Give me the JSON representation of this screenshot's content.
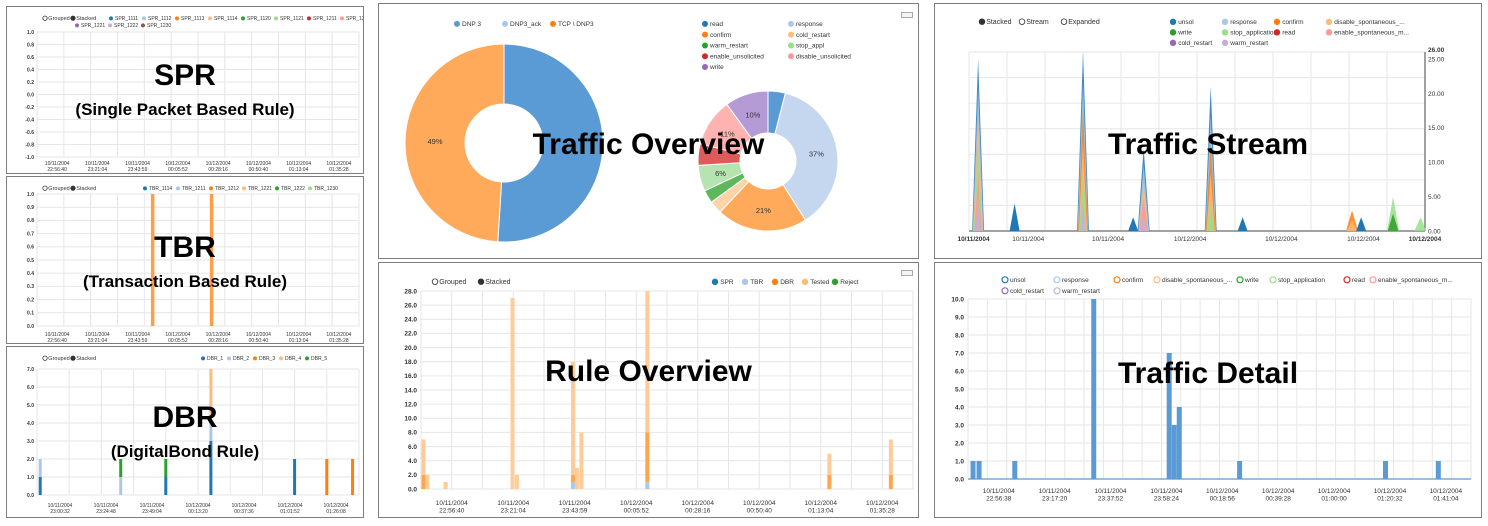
{
  "colors": {
    "blue": "#1f77b4",
    "lightblue": "#aec7e8",
    "orange": "#ff7f0e",
    "lightorange": "#ffbb78",
    "green": "#2ca02c",
    "lightgreen": "#98df8a",
    "red": "#d62728",
    "pink": "#ff9896",
    "purple": "#9467bd",
    "lavender": "#c5b0d5",
    "steelblue": "#5b9bd5"
  },
  "panels": {
    "spr": {
      "title": "SPR",
      "subtitle": "(Single Packet Based Rule)",
      "mode_labels": [
        "Grouped",
        "Stacked"
      ],
      "legend": [
        {
          "label": "SPR_1111",
          "color": "#1f77b4"
        },
        {
          "label": "SPR_1112",
          "color": "#aec7e8"
        },
        {
          "label": "SPR_1113",
          "color": "#ff7f0e"
        },
        {
          "label": "SPR_1114",
          "color": "#ffbb78"
        },
        {
          "label": "SPR_1120",
          "color": "#2ca02c"
        },
        {
          "label": "SPR_1121",
          "color": "#98df8a"
        },
        {
          "label": "SPR_1211",
          "color": "#d62728"
        },
        {
          "label": "SPR_1212",
          "color": "#ff9896"
        },
        {
          "label": "SPR_1221",
          "color": "#9467bd"
        },
        {
          "label": "SPR_1222",
          "color": "#c5b0d5"
        },
        {
          "label": "SPR_1230",
          "color": "#8c564b"
        }
      ],
      "y_ticks": [
        "1.0",
        "0.8",
        "0.6",
        "0.4",
        "0.2",
        "0.0",
        "-0.2",
        "-0.4",
        "-0.6",
        "-0.8",
        "-1.0"
      ],
      "x_ticks": [
        [
          "10/11/2004",
          "22:56:40"
        ],
        [
          "10/11/2004",
          "23:21:04"
        ],
        [
          "10/11/2004",
          "23:43:59"
        ],
        [
          "10/12/2004",
          "00:05:52"
        ],
        [
          "10/12/2004",
          "00:28:16"
        ],
        [
          "10/12/2004",
          "00:50:40"
        ],
        [
          "10/12/2004",
          "01:13:04"
        ],
        [
          "10/12/2004",
          "01:35:28"
        ]
      ]
    },
    "tbr": {
      "title": "TBR",
      "subtitle": "(Transaction Based Rule)",
      "mode_labels": [
        "Grouped",
        "Stacked"
      ],
      "legend": [
        {
          "label": "TBR_1114",
          "color": "#1f77b4"
        },
        {
          "label": "TBR_1211",
          "color": "#aec7e8"
        },
        {
          "label": "TBR_1212",
          "color": "#ff7f0e"
        },
        {
          "label": "TBR_1221",
          "color": "#ffbb78"
        },
        {
          "label": "TBR_1222",
          "color": "#2ca02c"
        },
        {
          "label": "TBR_1230",
          "color": "#98df8a"
        }
      ],
      "y_ticks": [
        "1.0",
        "0.9",
        "0.8",
        "0.7",
        "0.6",
        "0.5",
        "0.4",
        "0.3",
        "0.2",
        "0.1",
        "0.0"
      ],
      "x_ticks": [
        [
          "10/11/2004",
          "22:56:40"
        ],
        [
          "10/11/2004",
          "23:21:04"
        ],
        [
          "10/11/2004",
          "23:43:59"
        ],
        [
          "10/12/2004",
          "00:05:52"
        ],
        [
          "10/12/2004",
          "00:28:16"
        ],
        [
          "10/12/2004",
          "00:50:40"
        ],
        [
          "10/12/2004",
          "01:13:04"
        ],
        [
          "10/12/2004",
          "01:35:28"
        ]
      ]
    },
    "dbr": {
      "title": "DBR",
      "subtitle": "(DigitalBond Rule)",
      "mode_labels": [
        "Grouped",
        "Stacked"
      ],
      "legend": [
        {
          "label": "DBR_1",
          "color": "#1f77b4"
        },
        {
          "label": "DBR_2",
          "color": "#aec7e8"
        },
        {
          "label": "DBR_3",
          "color": "#ff7f0e"
        },
        {
          "label": "DBR_4",
          "color": "#ffbb78"
        },
        {
          "label": "DBR_5",
          "color": "#2ca02c"
        }
      ],
      "y_ticks": [
        "7.0",
        "6.0",
        "5.0",
        "4.0",
        "3.0",
        "2.0",
        "1.0",
        "0.0"
      ],
      "x_ticks": [
        [
          "10/11/2004",
          "23:00:32"
        ],
        [
          "10/11/2004",
          "23:24:48"
        ],
        [
          "10/11/2004",
          "23:49:04"
        ],
        [
          "10/12/2004",
          "00:13:20"
        ],
        [
          "10/12/2004",
          "00:37:36"
        ],
        [
          "10/12/2004",
          "01:01:52"
        ],
        [
          "10/12/2004",
          "01:26:08"
        ]
      ]
    },
    "traffic_overview": {
      "title": "Traffic Overview",
      "left_legend": [
        {
          "label": "DNP 3",
          "color": "#5b9bd5"
        },
        {
          "label": "DNP3_ack",
          "color": "#aec7e8"
        },
        {
          "label": "TCP \\ DNP3",
          "color": "#ff7f0e"
        }
      ],
      "right_legend": [
        {
          "label": "read",
          "color": "#1f77b4"
        },
        {
          "label": "response",
          "color": "#aec7e8"
        },
        {
          "label": "confirm",
          "color": "#ff7f0e"
        },
        {
          "label": "cold_restart",
          "color": "#ffbb78"
        },
        {
          "label": "warm_restart",
          "color": "#2ca02c"
        },
        {
          "label": "stop_appl",
          "color": "#98df8a"
        },
        {
          "label": "enable_unsolicited",
          "color": "#d62728"
        },
        {
          "label": "disable_unsolicited",
          "color": "#ff9896"
        },
        {
          "label": "write",
          "color": "#9467bd"
        }
      ],
      "left_pie_labels": {
        "orange": "49%"
      },
      "right_pie_labels": {
        "response": "37%",
        "confirm": "21%",
        "stop_appl": "6%",
        "disable_unsolicited": "11%",
        "write": "10%"
      }
    },
    "rule_overview": {
      "title": "Rule Overview",
      "mode_labels": [
        "Grouped",
        "Stacked"
      ],
      "legend": [
        {
          "label": "SPR",
          "color": "#1f77b4"
        },
        {
          "label": "TBR",
          "color": "#aec7e8"
        },
        {
          "label": "DBR",
          "color": "#ff7f0e"
        },
        {
          "label": "Tested",
          "color": "#ffbb78"
        },
        {
          "label": "Reject",
          "color": "#2ca02c"
        }
      ],
      "y_ticks": [
        "28.0",
        "26.0",
        "24.0",
        "22.0",
        "20.0",
        "18.0",
        "16.0",
        "14.0",
        "12.0",
        "10.0",
        "8.0",
        "6.0",
        "4.0",
        "2.0",
        "0.0"
      ],
      "x_ticks": [
        [
          "10/11/2004",
          "22:56:40"
        ],
        [
          "10/11/2004",
          "23:21:04"
        ],
        [
          "10/11/2004",
          "23:43:59"
        ],
        [
          "10/12/2004",
          "00:05:52"
        ],
        [
          "10/12/2004",
          "00:28:16"
        ],
        [
          "10/12/2004",
          "00:50:40"
        ],
        [
          "10/12/2004",
          "01:13:04"
        ],
        [
          "10/12/2004",
          "01:35:28"
        ]
      ]
    },
    "traffic_stream": {
      "title": "Traffic Stream",
      "mode_labels": [
        "Stacked",
        "Stream",
        "Expanded"
      ],
      "legend": [
        {
          "label": "unsol",
          "color": "#1f77b4"
        },
        {
          "label": "response",
          "color": "#aec7e8"
        },
        {
          "label": "confirm",
          "color": "#ff7f0e"
        },
        {
          "label": "disable_spontaneous_...",
          "color": "#ffbb78"
        },
        {
          "label": "write",
          "color": "#2ca02c"
        },
        {
          "label": "stop_application",
          "color": "#98df8a"
        },
        {
          "label": "read",
          "color": "#d62728"
        },
        {
          "label": "enable_spontaneous_m...",
          "color": "#ff9896"
        },
        {
          "label": "cold_restart",
          "color": "#9467bd"
        },
        {
          "label": "warm_restart",
          "color": "#c5b0d5"
        }
      ],
      "y_ticks": [
        "26.00",
        "25.00",
        "20.00",
        "15.00",
        "10.00",
        "5.00",
        "0.00"
      ],
      "x_ticks": [
        "10/11/2004",
        "10/11/2004",
        "10/11/2004",
        "10/12/2004",
        "10/12/2004",
        "10/12/2004",
        "10/12/2004"
      ]
    },
    "traffic_detail": {
      "title": "Traffic Detail",
      "legend": [
        {
          "label": "unsol",
          "color": "#1f77b4"
        },
        {
          "label": "response",
          "color": "#aec7e8"
        },
        {
          "label": "confirm",
          "color": "#ff7f0e"
        },
        {
          "label": "disable_spontaneous_...",
          "color": "#ffbb78"
        },
        {
          "label": "write",
          "color": "#2ca02c"
        },
        {
          "label": "stop_application",
          "color": "#98df8a"
        },
        {
          "label": "read",
          "color": "#d62728"
        },
        {
          "label": "enable_spontaneous_m...",
          "color": "#ff9896"
        },
        {
          "label": "cold_restart",
          "color": "#9467bd"
        },
        {
          "label": "warm_restart",
          "color": "#c5b0d5"
        }
      ],
      "y_ticks": [
        "10.0",
        "9.0",
        "8.0",
        "7.0",
        "6.0",
        "5.0",
        "4.0",
        "3.0",
        "2.0",
        "1.0",
        "0.0"
      ],
      "x_ticks": [
        [
          "10/11/2004",
          "22:56:38"
        ],
        [
          "10/11/2004",
          "23:17:20"
        ],
        [
          "10/11/2004",
          "23:37:52"
        ],
        [
          "10/11/2004",
          "23:58:24"
        ],
        [
          "10/12/2004",
          "00:18:56"
        ],
        [
          "10/12/2004",
          "00:39:28"
        ],
        [
          "10/12/2004",
          "01:00:00"
        ],
        [
          "10/12/2004",
          "01:20:32"
        ],
        [
          "10/12/2004",
          "01:41:04"
        ]
      ]
    }
  },
  "chart_data": [
    {
      "type": "bar",
      "name_ref": "tbr",
      "ylim": [
        0,
        1
      ],
      "series": [
        {
          "name": "TBR_1212",
          "points": [
            {
              "x": 0.36,
              "y": 1.0
            },
            {
              "x": 0.543,
              "y": 1.0
            }
          ]
        }
      ]
    },
    {
      "type": "bar",
      "name_ref": "dbr",
      "ylim": [
        0,
        7
      ],
      "bars": [
        {
          "x": 0.01,
          "segments": [
            {
              "c": "#1f77b4",
              "v": 1.0
            },
            {
              "c": "#aec7e8",
              "v": 1.0
            }
          ]
        },
        {
          "x": 0.26,
          "segments": [
            {
              "c": "#aec7e8",
              "v": 1.0
            },
            {
              "c": "#2ca02c",
              "v": 1.0
            }
          ]
        },
        {
          "x": 0.4,
          "segments": [
            {
              "c": "#1f77b4",
              "v": 1.0
            },
            {
              "c": "#2ca02c",
              "v": 1.0
            }
          ]
        },
        {
          "x": 0.54,
          "segments": [
            {
              "c": "#1f77b4",
              "v": 3.0
            },
            {
              "c": "#aec7e8",
              "v": 1.0
            },
            {
              "c": "#ffbb78",
              "v": 3.0
            }
          ]
        },
        {
          "x": 0.8,
          "segments": [
            {
              "c": "#1f77b4",
              "v": 2.0
            }
          ]
        },
        {
          "x": 0.9,
          "segments": [
            {
              "c": "#ff7f0e",
              "v": 2.0
            }
          ]
        },
        {
          "x": 0.98,
          "segments": [
            {
              "c": "#ff7f0e",
              "v": 2.0
            }
          ]
        }
      ]
    },
    {
      "type": "pie",
      "name_ref": "traffic_overview_left",
      "slices": [
        {
          "label": "DNP 3",
          "value": 51,
          "color": "#5b9bd5"
        },
        {
          "label": "TCP \\ DNP3",
          "value": 49,
          "color": "#ffaa5a"
        }
      ]
    },
    {
      "type": "pie",
      "name_ref": "traffic_overview_right",
      "slices": [
        {
          "label": "read",
          "value": 4,
          "color": "#5b9bd5"
        },
        {
          "label": "response",
          "value": 37,
          "color": "#c5d7ef"
        },
        {
          "label": "confirm",
          "value": 21,
          "color": "#ffaa5a"
        },
        {
          "label": "cold_restart",
          "value": 3,
          "color": "#ffd3a8"
        },
        {
          "label": "warm_restart",
          "value": 3,
          "color": "#5db85d"
        },
        {
          "label": "stop_appl",
          "value": 6,
          "color": "#b6e4b0"
        },
        {
          "label": "enable_unsolicited",
          "value": 5,
          "color": "#e05a5a"
        },
        {
          "label": "disable_unsolicited",
          "value": 11,
          "color": "#ffb3b0"
        },
        {
          "label": "write",
          "value": 10,
          "color": "#b59bd6"
        }
      ]
    },
    {
      "type": "bar",
      "name_ref": "rule_overview",
      "ylim": [
        0,
        28
      ],
      "bars": [
        {
          "x": 0.005,
          "segments": [
            {
              "c": "#ffa64d",
              "v": 2.0
            },
            {
              "c": "#ffcc99",
              "v": 5.0
            }
          ]
        },
        {
          "x": 0.013,
          "segments": [
            {
              "c": "#ffcc99",
              "v": 2.0
            }
          ]
        },
        {
          "x": 0.05,
          "segments": [
            {
              "c": "#ffcc99",
              "v": 1.0
            }
          ]
        },
        {
          "x": 0.186,
          "segments": [
            {
              "c": "#ffcc99",
              "v": 27.0
            }
          ]
        },
        {
          "x": 0.195,
          "segments": [
            {
              "c": "#ffcc99",
              "v": 2.0
            }
          ]
        },
        {
          "x": 0.309,
          "segments": [
            {
              "c": "#aec7e8",
              "v": 1.0
            },
            {
              "c": "#ffa64d",
              "v": 1.0
            },
            {
              "c": "#ffcc99",
              "v": 16.0
            }
          ]
        },
        {
          "x": 0.317,
          "segments": [
            {
              "c": "#ffcc99",
              "v": 3.0
            }
          ]
        },
        {
          "x": 0.326,
          "segments": [
            {
              "c": "#ffcc99",
              "v": 8.0
            }
          ]
        },
        {
          "x": 0.46,
          "segments": [
            {
              "c": "#aec7e8",
              "v": 1.0
            },
            {
              "c": "#ffa64d",
              "v": 7.0
            },
            {
              "c": "#ffcc99",
              "v": 20.0
            }
          ]
        },
        {
          "x": 0.83,
          "segments": [
            {
              "c": "#ffa64d",
              "v": 2.0
            },
            {
              "c": "#ffcc99",
              "v": 3.0
            }
          ]
        },
        {
          "x": 0.955,
          "segments": [
            {
              "c": "#ffa64d",
              "v": 2.0
            },
            {
              "c": "#ffcc99",
              "v": 5.0
            }
          ]
        }
      ]
    },
    {
      "type": "bar",
      "name_ref": "traffic_detail",
      "ylim": [
        0,
        10
      ],
      "bars": [
        {
          "x": 0.01,
          "v": 1
        },
        {
          "x": 0.022,
          "v": 1
        },
        {
          "x": 0.093,
          "v": 1
        },
        {
          "x": 0.25,
          "v": 10
        },
        {
          "x": 0.4,
          "v": 7
        },
        {
          "x": 0.41,
          "v": 3
        },
        {
          "x": 0.42,
          "v": 4
        },
        {
          "x": 0.54,
          "v": 1
        },
        {
          "x": 0.83,
          "v": 1
        },
        {
          "x": 0.935,
          "v": 1
        }
      ]
    },
    {
      "type": "area",
      "name_ref": "traffic_stream",
      "ylim": [
        0,
        26
      ],
      "spikes": [
        {
          "x": 0.02,
          "peak": 25,
          "colors": [
            "#1f77b4",
            "#aec7e8",
            "#ffbb78",
            "#98df8a",
            "#ff9896",
            "#c5b0d5"
          ]
        },
        {
          "x": 0.25,
          "peak": 26,
          "colors": [
            "#1f77b4",
            "#aec7e8",
            "#ff7f0e",
            "#ffbb78",
            "#98df8a",
            "#c5b0d5"
          ]
        },
        {
          "x": 0.383,
          "peak": 12,
          "colors": [
            "#1f77b4",
            "#aec7e8",
            "#ffbb78",
            "#ff9896",
            "#c5b0d5"
          ]
        },
        {
          "x": 0.53,
          "peak": 21,
          "colors": [
            "#1f77b4",
            "#aec7e8",
            "#ff7f0e",
            "#ffbb78",
            "#98df8a"
          ]
        },
        {
          "x": 0.84,
          "peak": 3,
          "colors": [
            "#ff7f0e",
            "#ffbb78"
          ]
        },
        {
          "x": 0.93,
          "peak": 5,
          "colors": [
            "#98df8a",
            "#2ca02c"
          ]
        },
        {
          "x": 0.99,
          "peak": 2,
          "colors": [
            "#98df8a"
          ]
        }
      ],
      "small": [
        {
          "x": 0.1,
          "h": 1
        },
        {
          "x": 0.36,
          "h": 0.5
        },
        {
          "x": 0.6,
          "h": 0.5
        },
        {
          "x": 0.86,
          "h": 0.5
        }
      ]
    }
  ]
}
